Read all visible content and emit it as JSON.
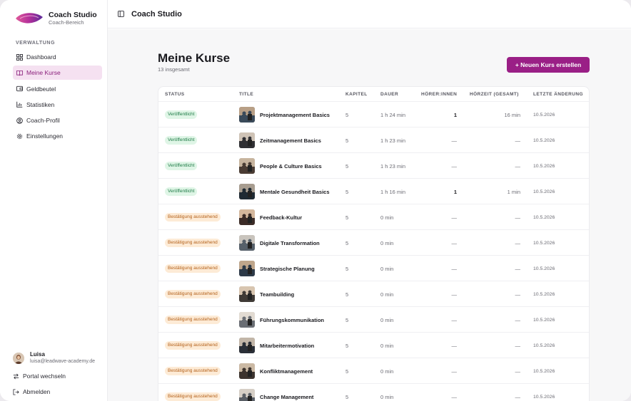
{
  "app": {
    "name": "Coach Studio",
    "subtitle": "Coach-Bereich"
  },
  "sidebar": {
    "section_label": "VERWALTUNG",
    "items": [
      {
        "label": "Dashboard",
        "icon": "grid-icon",
        "active": false
      },
      {
        "label": "Meine Kurse",
        "icon": "book-icon",
        "active": true
      },
      {
        "label": "Geldbeutel",
        "icon": "wallet-icon",
        "active": false
      },
      {
        "label": "Statistiken",
        "icon": "chart-icon",
        "active": false
      },
      {
        "label": "Coach-Profil",
        "icon": "user-circle-icon",
        "active": false
      },
      {
        "label": "Einstellungen",
        "icon": "gear-icon",
        "active": false
      }
    ],
    "user": {
      "name": "Luisa",
      "email": "luisa@leadwave-academy.de"
    },
    "switch_portal": "Portal wechseln",
    "logout": "Abmelden"
  },
  "topbar": {
    "title": "Coach Studio"
  },
  "main": {
    "title": "Meine Kurse",
    "count": "13 insgesamt",
    "new_button": "+ Neuen Kurs erstellen",
    "columns": [
      "STATUS",
      "TITLE",
      "KAPITEL",
      "DAUER",
      "HÖRER:INNEN",
      "HÖRZEIT (GESAMT)",
      "LETZTE ÄNDERUNG"
    ],
    "rows": [
      {
        "status": "Veröffentlicht",
        "status_type": "pub",
        "title": "Projektmanagement Basics",
        "chapters": "5",
        "duration": "1 h 24 min",
        "listeners": "1",
        "listen_time": "16 min",
        "updated": "10.5.2026"
      },
      {
        "status": "Veröffentlicht",
        "status_type": "pub",
        "title": "Zeitmanagement Basics",
        "chapters": "5",
        "duration": "1 h 23 min",
        "listeners": "—",
        "listen_time": "—",
        "updated": "10.5.2026"
      },
      {
        "status": "Veröffentlicht",
        "status_type": "pub",
        "title": "People & Culture Basics",
        "chapters": "5",
        "duration": "1 h 23 min",
        "listeners": "—",
        "listen_time": "—",
        "updated": "10.5.2026"
      },
      {
        "status": "Veröffentlicht",
        "status_type": "pub",
        "title": "Mentale Gesundheit Basics",
        "chapters": "5",
        "duration": "1 h 16 min",
        "listeners": "1",
        "listen_time": "1 min",
        "updated": "10.5.2026"
      },
      {
        "status": "Bestätigung ausstehend",
        "status_type": "pending",
        "title": "Feedback-Kultur",
        "chapters": "5",
        "duration": "0 min",
        "listeners": "—",
        "listen_time": "—",
        "updated": "10.5.2026"
      },
      {
        "status": "Bestätigung ausstehend",
        "status_type": "pending",
        "title": "Digitale Transformation",
        "chapters": "5",
        "duration": "0 min",
        "listeners": "—",
        "listen_time": "—",
        "updated": "10.5.2026"
      },
      {
        "status": "Bestätigung ausstehend",
        "status_type": "pending",
        "title": "Strategische Planung",
        "chapters": "5",
        "duration": "0 min",
        "listeners": "—",
        "listen_time": "—",
        "updated": "10.5.2026"
      },
      {
        "status": "Bestätigung ausstehend",
        "status_type": "pending",
        "title": "Teambuilding",
        "chapters": "5",
        "duration": "0 min",
        "listeners": "—",
        "listen_time": "—",
        "updated": "10.5.2026"
      },
      {
        "status": "Bestätigung ausstehend",
        "status_type": "pending",
        "title": "Führungskommunikation",
        "chapters": "5",
        "duration": "0 min",
        "listeners": "—",
        "listen_time": "—",
        "updated": "10.5.2026"
      },
      {
        "status": "Bestätigung ausstehend",
        "status_type": "pending",
        "title": "Mitarbeitermotivation",
        "chapters": "5",
        "duration": "0 min",
        "listeners": "—",
        "listen_time": "—",
        "updated": "10.5.2026"
      },
      {
        "status": "Bestätigung ausstehend",
        "status_type": "pending",
        "title": "Konfliktmanagement",
        "chapters": "5",
        "duration": "0 min",
        "listeners": "—",
        "listen_time": "—",
        "updated": "10.5.2026"
      },
      {
        "status": "Bestätigung ausstehend",
        "status_type": "pending",
        "title": "Change Management",
        "chapters": "5",
        "duration": "0 min",
        "listeners": "—",
        "listen_time": "—",
        "updated": "10.5.2026"
      }
    ]
  },
  "colors": {
    "accent": "#9a1f86",
    "active_bg": "#f5e1f1",
    "published_bg": "#dff5e6",
    "published_fg": "#1d7a45",
    "pending_bg": "#fdebd6",
    "pending_fg": "#b3601a"
  }
}
